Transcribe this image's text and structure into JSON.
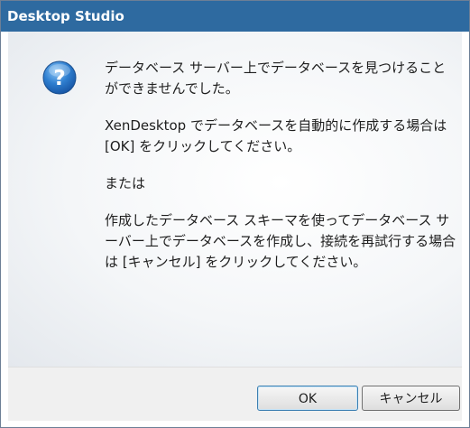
{
  "window": {
    "title": "Desktop Studio"
  },
  "dialog": {
    "icon": "question-icon",
    "paragraphs": [
      "データベース サーバー上でデータベースを見つけることができませんでした。",
      "XenDesktop でデータベースを自動的に作成する場合は [OK] をクリックしてください。",
      "または",
      "作成したデータベース スキーマを使ってデータベース サーバー上でデータベースを作成し、接続を再試行する場合は [キャンセル] をクリックしてください。"
    ]
  },
  "buttons": {
    "ok_label": "OK",
    "cancel_label": "キャンセル"
  },
  "colors": {
    "titlebar": "#2e6aa0",
    "icon_blue": "#2f7fd0",
    "footer": "#f0f0f0"
  }
}
